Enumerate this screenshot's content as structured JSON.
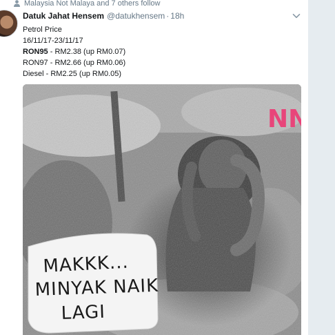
{
  "social_context": {
    "text": "Malaysia Not Malaya and 7 others follow",
    "icon": "person-icon"
  },
  "tweet": {
    "display_name": "Datuk Jahat Hensem",
    "username": "@datukhensem",
    "separator": "·",
    "timestamp": "18h",
    "lines": {
      "l1": "Petrol Price",
      "l2": "16/11/17-23/11/17",
      "ron95_label": "RON95",
      "ron95_value": " - RM2.38 (up RM0.07)",
      "ron97": "RON97 - RM2.66 (up RM0.06)",
      "diesel": "Diesel - RM2.25 (up RM0.05)"
    },
    "media": {
      "watermark": "NN",
      "caption_lines": [
        "MAKKK...",
        "MINYAK NAIK",
        "LAGI"
      ]
    }
  },
  "colors": {
    "secondary_text": "#657786",
    "primary_text": "#14171a",
    "gutter": "#e6ecf0",
    "watermark_pink": "#e8457a",
    "watermark_green": "#3ec46d"
  }
}
